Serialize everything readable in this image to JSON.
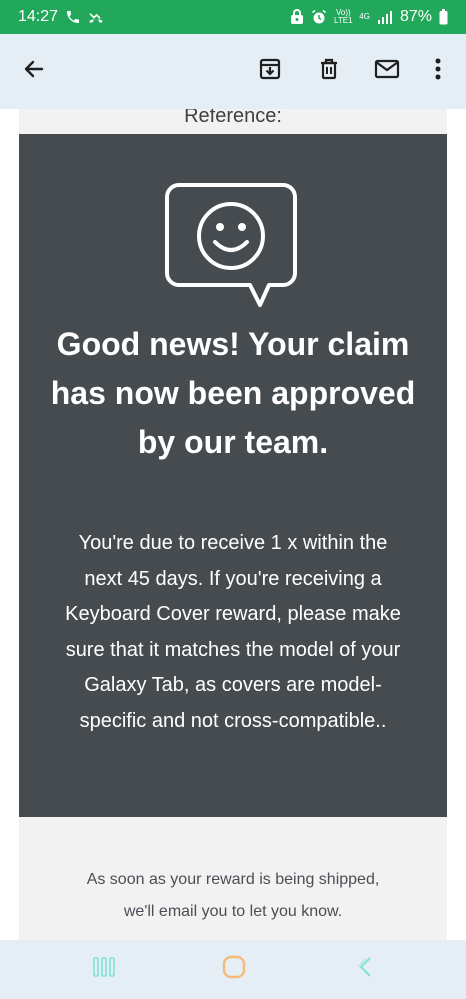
{
  "status_bar": {
    "time": "14:27",
    "volte_label": "Vo)) LTE1",
    "network_label": "4G",
    "battery_percent": "87%",
    "icons": [
      "phone-call-icon",
      "missed-call-icon",
      "lock-face-icon",
      "alarm-icon",
      "volte-icon",
      "4g-icon",
      "signal-icon",
      "battery-icon"
    ]
  },
  "toolbar": {
    "icons": [
      "back-arrow-icon",
      "archive-icon",
      "delete-icon",
      "mark-unread-icon",
      "more-options-icon"
    ]
  },
  "email": {
    "reference_label": "Reference:",
    "headline": "Good news! Your claim has now been approved by our team.",
    "body": "You're due to receive 1 x within the next 45 days. If you're receiving a Keyboard Cover reward, please make sure that it matches the model of your Galaxy Tab, as covers are model-specific and not cross-compatible..",
    "footer": "As soon as your reward is being shipped, we'll email you to let you know.",
    "icon": "smiley-chat-bubble-icon"
  },
  "nav_bar": {
    "icons": [
      "recent-apps-icon",
      "home-icon",
      "back-icon"
    ]
  },
  "colors": {
    "status_bar": "#22a85b",
    "toolbar": "#e6eef5",
    "card": "#464b50",
    "frame": "#f2f2f2",
    "nav_accent": "#7fe3d6",
    "home_accent": "#f5b979"
  }
}
